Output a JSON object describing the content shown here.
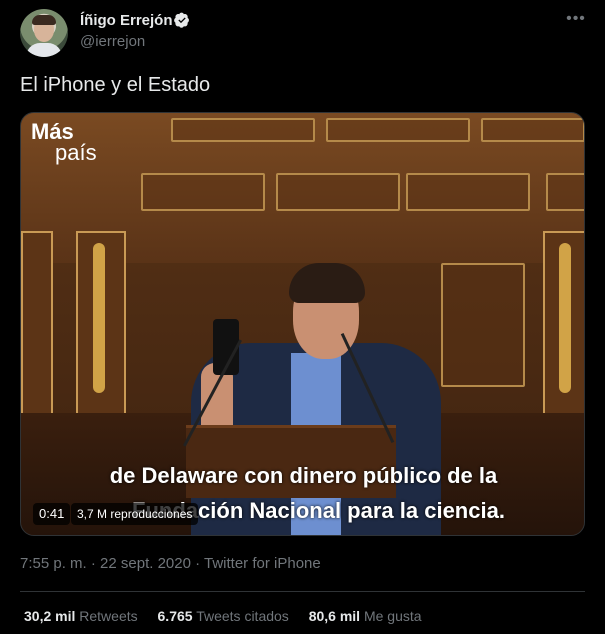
{
  "author": {
    "name": "Íñigo Errejón",
    "handle": "@ierrejon",
    "verified": true
  },
  "tweet": {
    "text": "El iPhone y el Estado"
  },
  "media": {
    "logo_line1": "Más",
    "logo_line2": "país",
    "subtitle_line1": "de Delaware con dinero público de la",
    "subtitle_line2": "Fundación Nacional para la ciencia.",
    "duration": "0:41",
    "views": "3,7 M reproducciones"
  },
  "meta": {
    "timestamp": "7:55 p. m. · 22 sept. 2020 · Twitter for iPhone"
  },
  "stats": [
    {
      "count": "30,2 mil",
      "label": "Retweets"
    },
    {
      "count": "6.765",
      "label": "Tweets citados"
    },
    {
      "count": "80,6 mil",
      "label": "Me gusta"
    }
  ],
  "colors": {
    "background": "#000000",
    "text_primary": "#e7e9ea",
    "text_secondary": "#71767b",
    "verified_badge": "#e7e9ea",
    "border": "#2f3336"
  },
  "icons": {
    "verified": "verified-badge-icon",
    "more": "more-options-icon"
  }
}
